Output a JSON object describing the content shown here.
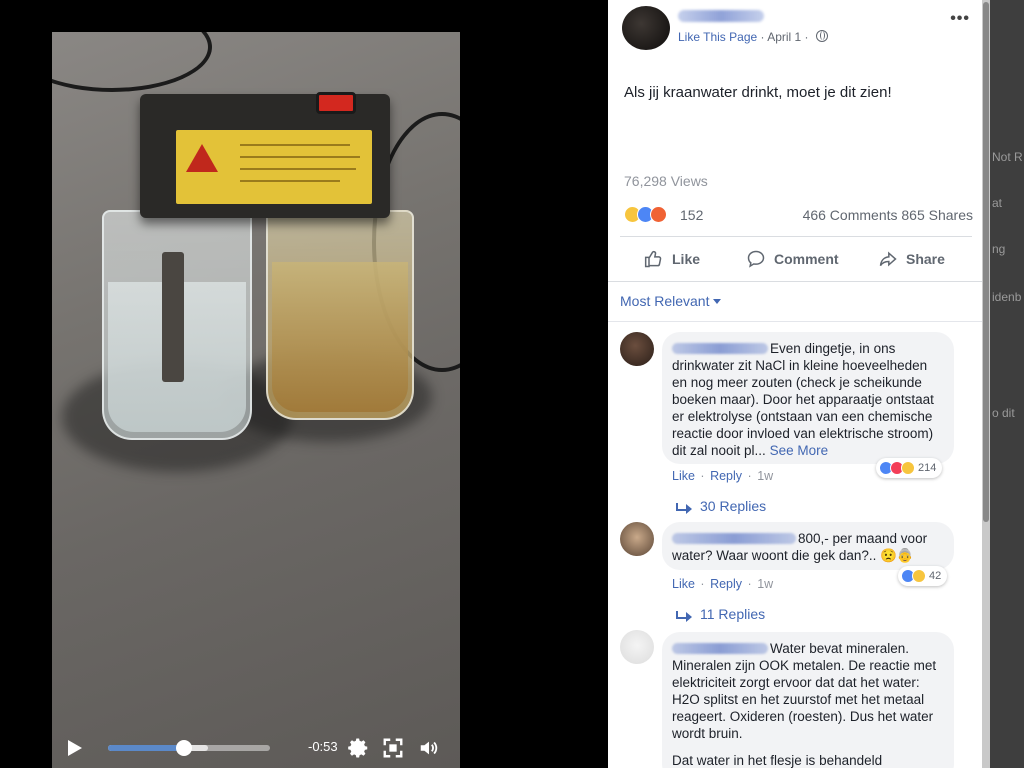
{
  "video": {
    "time_remaining": "-0:53",
    "progress_fraction": 0.47,
    "buffered_fraction": 0.62,
    "icons": [
      "play-icon",
      "settings-icon",
      "fullscreen-icon",
      "volume-icon"
    ]
  },
  "post": {
    "like_page_label": "Like This Page",
    "date": "April 1",
    "separator": "·",
    "text": "Als jij kraanwater drinkt, moet je dit zien!",
    "views": "76,298 Views",
    "reaction_count": "152",
    "comments_count": "466 Comments",
    "shares_count": "865 Shares",
    "actions": {
      "like": "Like",
      "comment": "Comment",
      "share": "Share"
    },
    "sort_label": "Most Relevant"
  },
  "comments": [
    {
      "text": "Even dingetje, in ons drinkwater zit NaCl in kleine hoeveelheden en nog meer zouten (check je scheikunde boeken maar). Door het apparaatje ontstaat er elektrolyse (ontstaan van een chemische reactie door invloed van elektrische stroom) dit zal nooit pl...",
      "see_more": "See More",
      "reaction_count": "214",
      "like": "Like",
      "reply": "Reply",
      "age": "1w",
      "replies": "30 Replies"
    },
    {
      "text": "800,- per maand voor water? Waar woont die gek dan?.. 😟👵",
      "reaction_count": "42",
      "like": "Like",
      "reply": "Reply",
      "age": "1w",
      "replies": "11 Replies"
    },
    {
      "text": "Water bevat mineralen. Mineralen zijn OOK metalen. De reactie met elektriciteit zorgt ervoor dat dat het water: H2O splitst en het zuurstof met het metaal reageert. Oxideren (roesten). Dus het water wordt bruin.",
      "text2": "Dat water in het flesje is behandeld"
    }
  ],
  "background_page": [
    "Not R",
    "at",
    "ng",
    "idenb",
    "o dit"
  ],
  "colors": {
    "link": "#4267b2",
    "video_progress": "#5b89c9",
    "bubble": "#f2f3f5"
  }
}
